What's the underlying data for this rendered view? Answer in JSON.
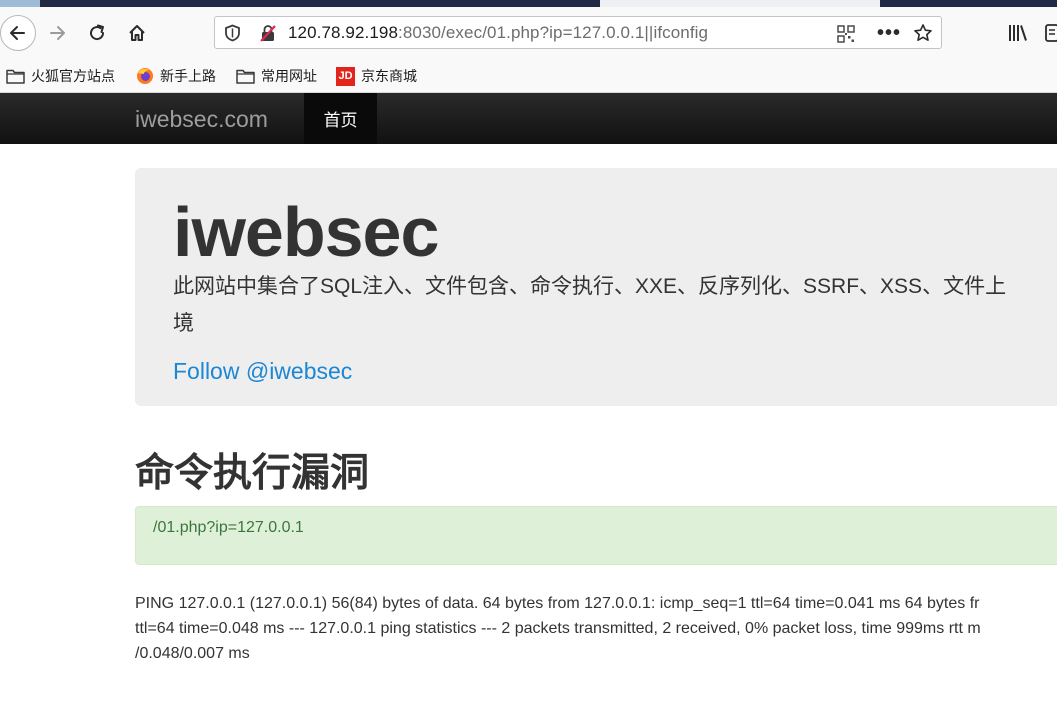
{
  "browser": {
    "url_host": "120.78.92.198",
    "url_rest": ":8030/exec/01.php?ip=127.0.0.1||ifconfig",
    "bookmarks": [
      {
        "label": "火狐官方站点",
        "icon": "folder-icon"
      },
      {
        "label": "新手上路",
        "icon": "firefox-icon"
      },
      {
        "label": "常用网址",
        "icon": "folder-icon"
      },
      {
        "label": "京东商城",
        "icon": "jd-icon"
      }
    ]
  },
  "site_nav": {
    "brand": "iwebsec.com",
    "home_label": "首页"
  },
  "jumbotron": {
    "title": "iwebsec",
    "description": "此网站中集合了SQL注入、文件包含、命令执行、XXE、反序列化、SSRF、XSS、文件上",
    "description_line2": "境",
    "follow_link": "Follow @iwebsec"
  },
  "section": {
    "title": "命令执行漏洞",
    "alert_text": "/01.php?ip=127.0.0.1",
    "output_lines": [
      "PING 127.0.0.1 (127.0.0.1) 56(84) bytes of data. 64 bytes from 127.0.0.1: icmp_seq=1 ttl=64 time=0.041 ms 64 bytes fr",
      "ttl=64 time=0.048 ms --- 127.0.0.1 ping statistics --- 2 packets transmitted, 2 received, 0% packet loss, time 999ms rtt m",
      "/0.048/0.007 ms"
    ]
  }
}
